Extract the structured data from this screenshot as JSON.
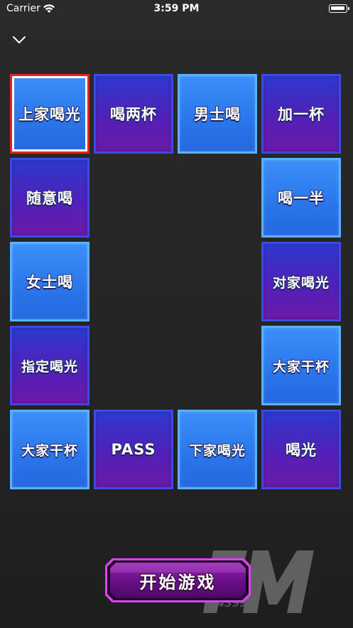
{
  "status_bar": {
    "carrier": "Carrier",
    "time": "3:59 PM",
    "wifi_icon": "wifi-icon",
    "battery_icon": "battery-icon"
  },
  "nav": {
    "back_icon": "chevron-down-icon"
  },
  "board": {
    "cells": [
      {
        "label": "上家喝光",
        "style": "blue",
        "selected": true
      },
      {
        "label": "喝两杯",
        "style": "purple"
      },
      {
        "label": "男士喝",
        "style": "blue"
      },
      {
        "label": "加一杯",
        "style": "purple"
      },
      {
        "label": "随意喝",
        "style": "purple"
      },
      {
        "label": "喝一半",
        "style": "blue"
      },
      {
        "label": "女士喝",
        "style": "blue"
      },
      {
        "label": "对家喝光",
        "style": "purple"
      },
      {
        "label": "指定喝光",
        "style": "purple"
      },
      {
        "label": "大家干杯",
        "style": "blue"
      },
      {
        "label": "大家干杯",
        "style": "blue"
      },
      {
        "label": "PASS",
        "style": "purple"
      },
      {
        "label": "下家喝光",
        "style": "blue"
      },
      {
        "label": "喝光",
        "style": "purple"
      }
    ]
  },
  "start_button": {
    "label": "开始游戏"
  },
  "watermark": {
    "logo": "FM",
    "sub": "4399"
  },
  "colors": {
    "blue_tile": "#2a75ea",
    "purple_tile": "#5220b8",
    "selected_border": "#e52222",
    "button_glow": "#e040fb"
  }
}
